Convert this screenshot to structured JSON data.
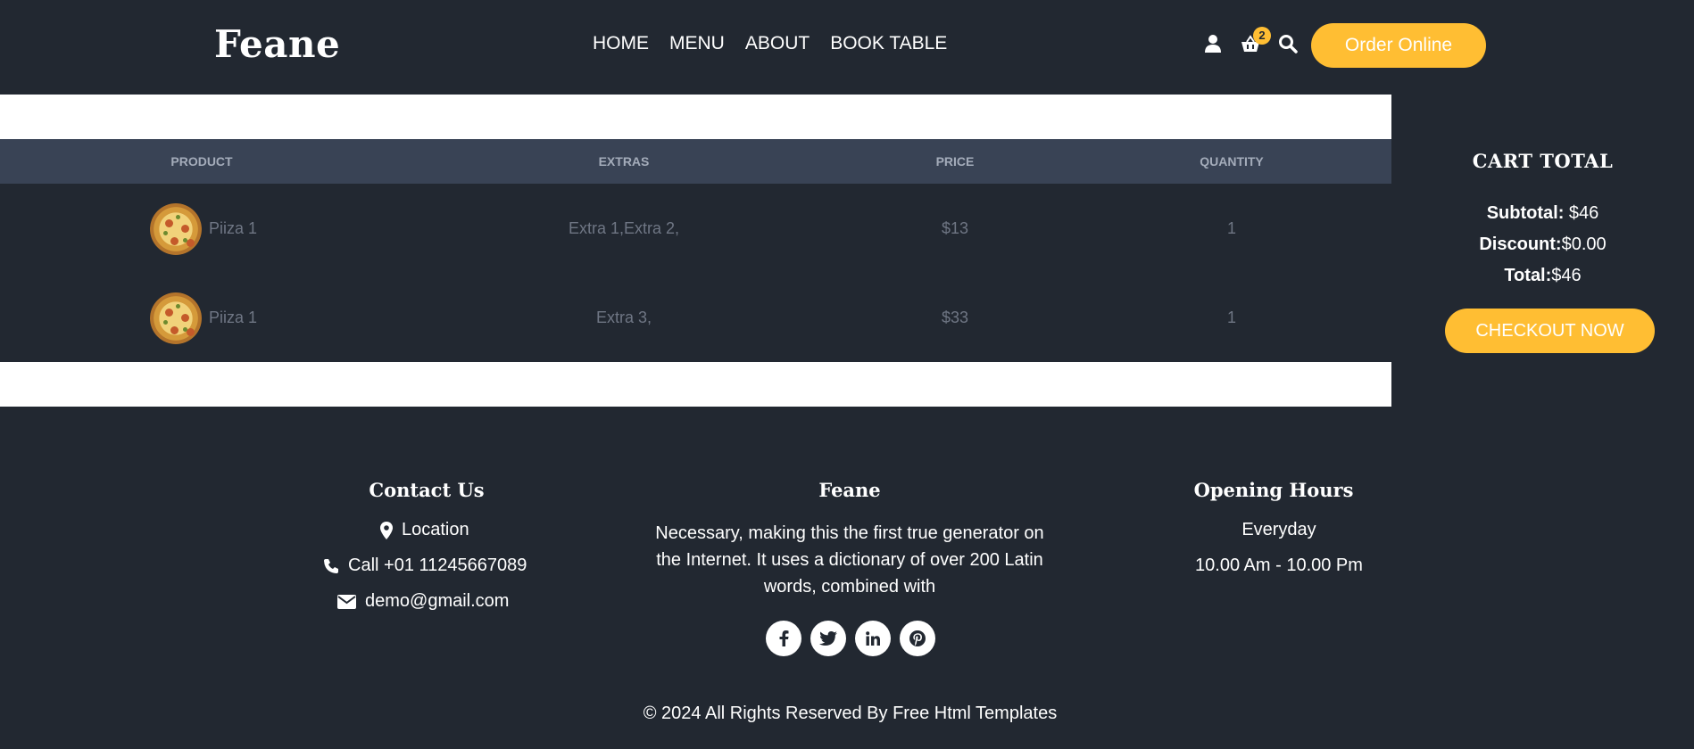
{
  "header": {
    "logo": "Feane",
    "nav": [
      "HOME",
      "MENU",
      "ABOUT",
      "BOOK TABLE"
    ],
    "cart_count": "2",
    "order_button": "Order Online",
    "icons": [
      "user-icon",
      "basket-icon",
      "search-icon"
    ]
  },
  "table": {
    "headers": [
      "PRODUCT",
      "EXTRAS",
      "PRICE",
      "QUANTITY"
    ],
    "rows": [
      {
        "product": "Piiza 1",
        "extras": "Extra 1,Extra 2,",
        "price": "$13",
        "quantity": "1"
      },
      {
        "product": "Piiza 1",
        "extras": "Extra 3,",
        "price": "$33",
        "quantity": "1"
      }
    ]
  },
  "cart": {
    "title": "CART TOTAL",
    "subtotal_label": "Subtotal:",
    "subtotal_value": " $46",
    "discount_label": "Discount:",
    "discount_value": "$0.00",
    "total_label": "Total:",
    "total_value": "$46",
    "checkout": "CHECKOUT NOW"
  },
  "footer": {
    "contact": {
      "title": "Contact Us",
      "location": "Location",
      "phone": "Call +01 11245667089",
      "email": "demo@gmail.com"
    },
    "about": {
      "title": "Feane",
      "text_lines": [
        "Necessary, making this the first true generator on",
        "the Internet. It uses a dictionary of over 200 Latin",
        "words, combined with"
      ],
      "social": [
        "facebook-icon",
        "twitter-icon",
        "linkedin-icon",
        "pinterest-icon"
      ]
    },
    "hours": {
      "title": "Opening Hours",
      "days": "Everyday",
      "time": "10.00 Am - 10.00 Pm"
    },
    "copyright": "© 2024 All Rights Reserved By Free Html Templates"
  },
  "colors": {
    "background": "#222831",
    "accent": "#ffbe33",
    "table_header": "#394355",
    "muted_text": "#6f7684"
  }
}
